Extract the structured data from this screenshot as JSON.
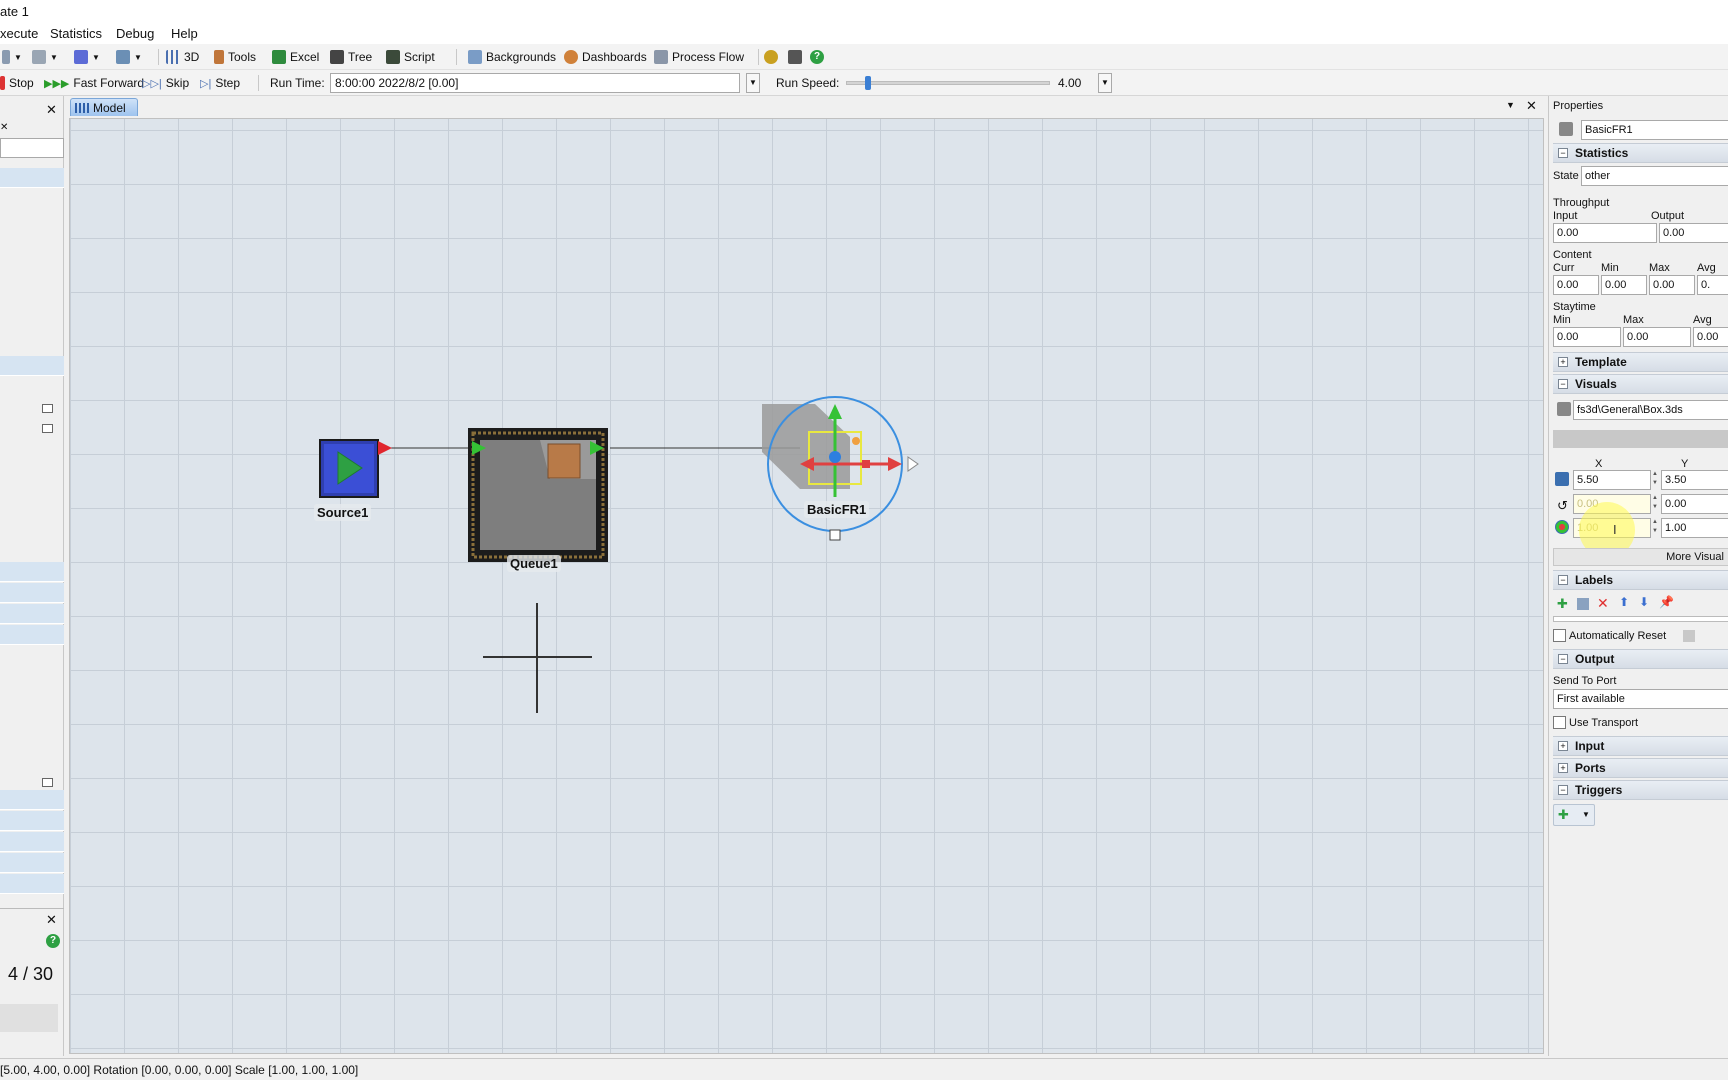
{
  "window": {
    "title": "ate 1"
  },
  "menu": [
    "xecute",
    "Statistics",
    "Debug",
    "Help"
  ],
  "toolbar1": {
    "btn_3d": "3D",
    "btn_tools": "Tools",
    "btn_excel": "Excel",
    "btn_tree": "Tree",
    "btn_script": "Script",
    "btn_backgrounds": "Backgrounds",
    "btn_dashboards": "Dashboards",
    "btn_process_flow": "Process Flow"
  },
  "toolbar2": {
    "btn_stop": "Stop",
    "btn_fast_forward": "Fast Forward",
    "btn_skip": "Skip",
    "btn_step": "Step",
    "run_time_label": "Run Time:",
    "run_time_value": "8:00:00  2022/8/2  [0.00]",
    "run_speed_label": "Run Speed:",
    "run_speed_value": "4.00",
    "run_speed_fraction": 0.09
  },
  "left_panel": {
    "counter": "4 / 30"
  },
  "model": {
    "tab_label": "Model",
    "objects": {
      "source": "Source1",
      "queue": "Queue1",
      "processor": "BasicFR1"
    }
  },
  "properties": {
    "header": "Properties",
    "object_name": "BasicFR1",
    "statistics": {
      "title": "Statistics",
      "state_label": "State",
      "state_value": "other",
      "throughput_label": "Throughput",
      "input_label": "Input",
      "output_label": "Output",
      "input_value": "0.00",
      "output_value": "0.00",
      "content_label": "Content",
      "curr_label": "Curr",
      "min_label": "Min",
      "max_label": "Max",
      "avg_label": "Avg",
      "curr_value": "0.00",
      "min_value": "0.00",
      "max_value": "0.00",
      "avg_value": "0.",
      "staytime_label": "Staytime",
      "st_min_label": "Min",
      "st_max_label": "Max",
      "st_avg_label": "Avg",
      "st_min_value": "0.00",
      "st_max_value": "0.00",
      "st_avg_value": "0.00"
    },
    "template": {
      "title": "Template"
    },
    "visuals": {
      "title": "Visuals",
      "shape": "fs3d\\General\\Box.3ds",
      "x_label": "X",
      "y_label": "Y",
      "pos_x": "5.50",
      "pos_y": "3.50",
      "rot_x": "0.00",
      "rot_y": "0.00",
      "scale_x": "1.00",
      "scale_y": "1.00",
      "more_visuals": "More Visual"
    },
    "labels": {
      "title": "Labels",
      "auto_reset": "Automatically Reset"
    },
    "output": {
      "title": "Output",
      "send_to_port_label": "Send To Port",
      "send_to_port_value": "First available",
      "use_transport": "Use Transport"
    },
    "input": {
      "title": "Input"
    },
    "ports": {
      "title": "Ports"
    },
    "triggers": {
      "title": "Triggers"
    }
  },
  "status_bar": {
    "text": "[5.00, 4.00, 0.00] Rotation [0.00, 0.00, 0.00] Scale [1.00, 1.00, 1.00]"
  },
  "colors": {
    "accent": "#3b7fd4",
    "grid_bg": "#dde4eb",
    "selection": "#e8e840"
  }
}
